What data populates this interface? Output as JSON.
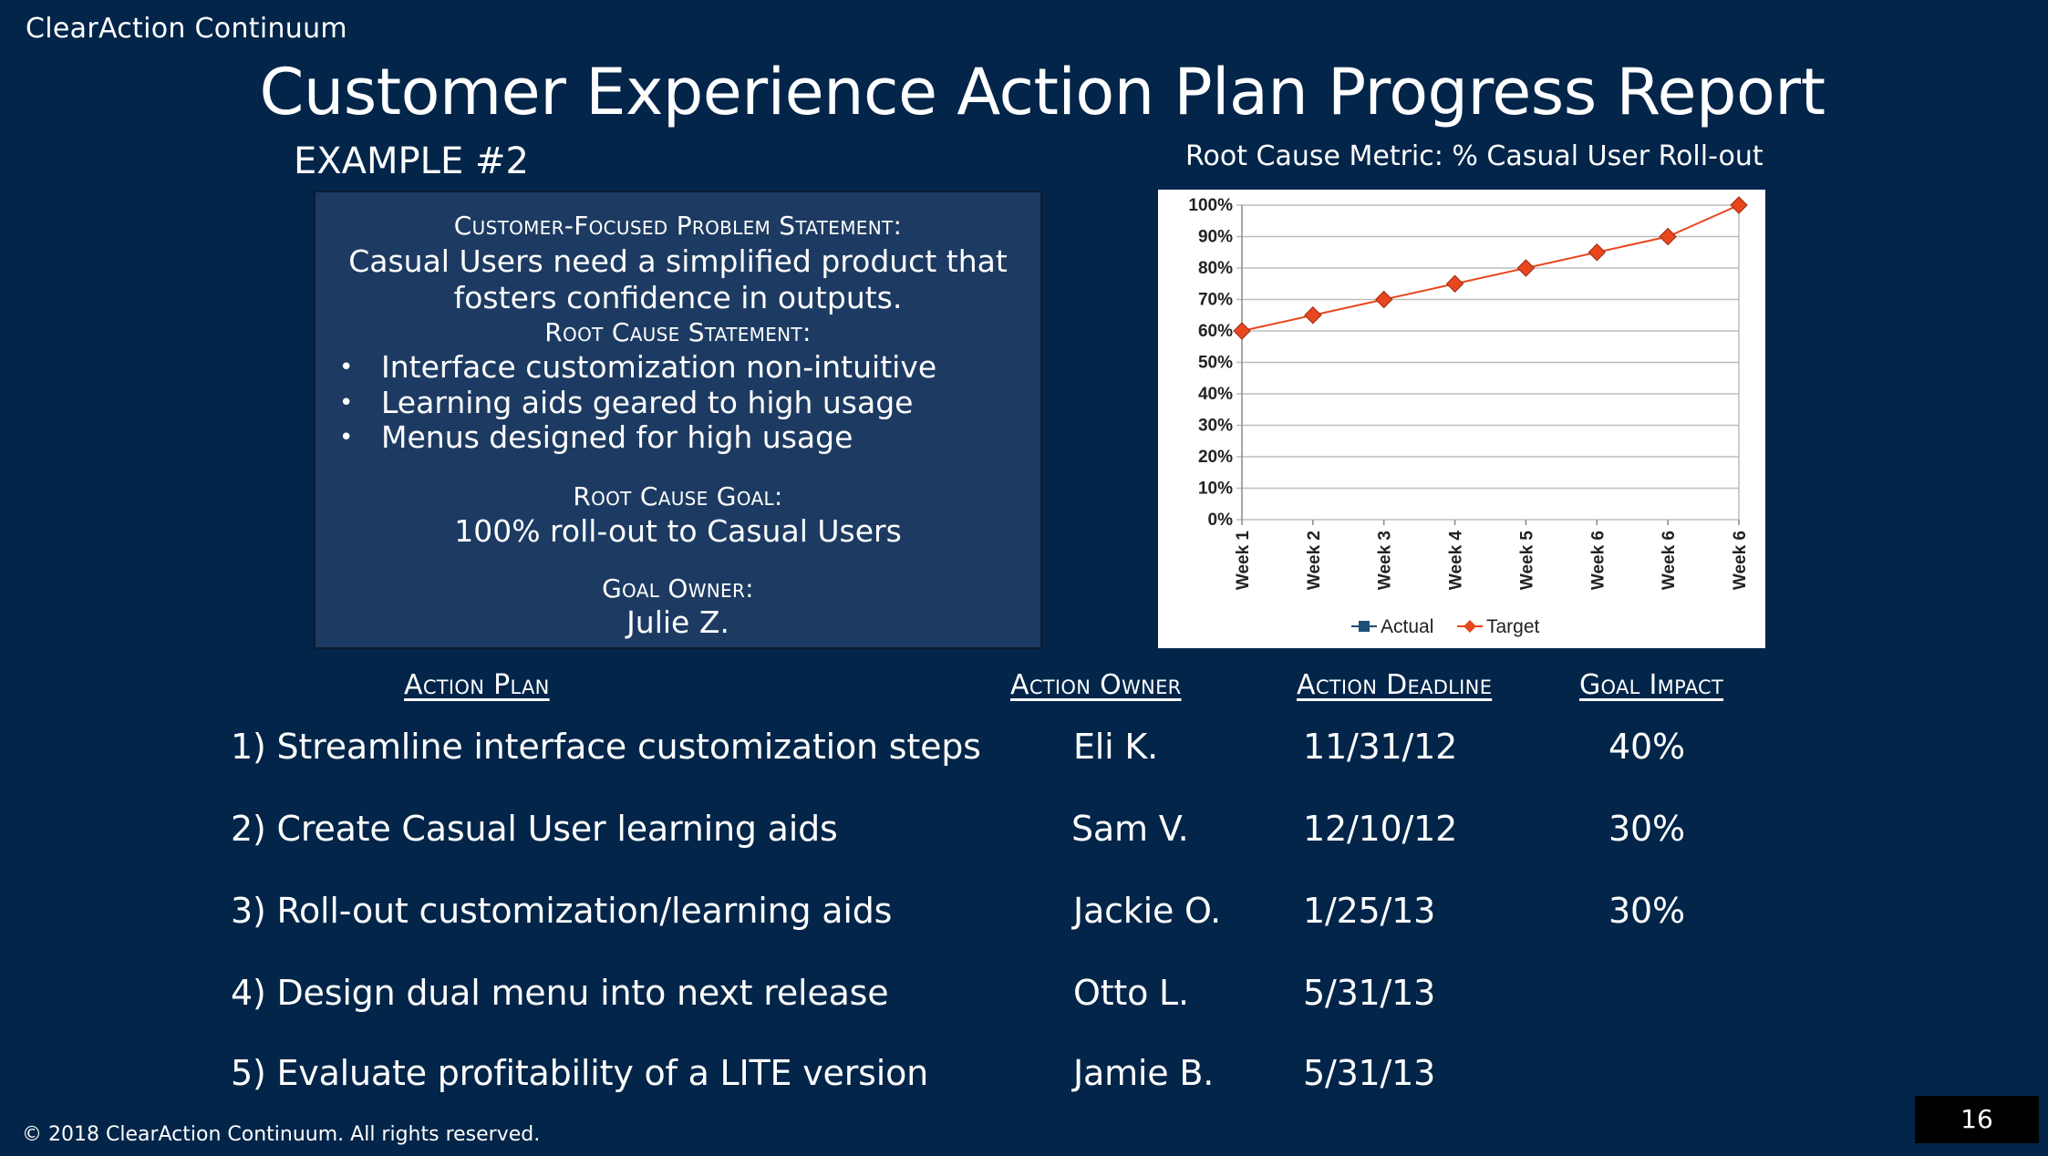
{
  "brand": "ClearAction Continuum",
  "title": "Customer Experience Action Plan Progress Report",
  "example": "EXAMPLE #2",
  "problem_box": {
    "problem_label": "Customer-Focused Problem Statement:",
    "problem_text_1": "Casual Users need a simplified product that",
    "problem_text_2": "fosters confidence in outputs.",
    "root_cause_label": "Root Cause Statement:",
    "root_causes": [
      "Interface customization non-intuitive",
      "Learning aids geared to high usage",
      "Menus designed for high usage"
    ],
    "goal_label": "Root Cause Goal:",
    "goal_text": "100% roll-out to Casual Users",
    "owner_label": "Goal Owner:",
    "owner_name": "Julie Z."
  },
  "chart_data": {
    "type": "line",
    "title": "Root Cause Metric: % Casual User Roll-out",
    "categories": [
      "Week 1",
      "Week 2",
      "Week 3",
      "Week 4",
      "Week 5",
      "Week 6",
      "Week 6",
      "Week 6"
    ],
    "y_ticks": [
      "0%",
      "10%",
      "20%",
      "30%",
      "40%",
      "50%",
      "60%",
      "70%",
      "80%",
      "90%",
      "100%"
    ],
    "ylim": [
      0,
      100
    ],
    "grid": true,
    "legend_position": "bottom",
    "series": [
      {
        "name": "Actual",
        "values": [],
        "color": "#1f4e79",
        "marker": "square"
      },
      {
        "name": "Target",
        "values": [
          60,
          65,
          70,
          75,
          80,
          85,
          90,
          100
        ],
        "color": "#e8471e",
        "marker": "diamond"
      }
    ]
  },
  "table": {
    "headers": {
      "plan": "Action Plan",
      "owner": "Action Owner",
      "deadline": "Action Deadline",
      "impact": "Goal Impact"
    },
    "rows": [
      {
        "plan": "1) Streamline interface customization steps",
        "owner": "Eli K.",
        "deadline": "11/31/12",
        "impact": "40%"
      },
      {
        "plan": "2) Create Casual User learning aids",
        "owner": "Sam V.",
        "deadline": "12/10/12",
        "impact": "30%"
      },
      {
        "plan": "3) Roll-out customization/learning aids",
        "owner": "Jackie O.",
        "deadline": "1/25/13",
        "impact": "30%"
      },
      {
        "plan": "4) Design dual menu into next release",
        "owner": "Otto L.",
        "deadline": "5/31/13",
        "impact": ""
      },
      {
        "plan": "5) Evaluate profitability of a LITE version",
        "owner": "Jamie B.",
        "deadline": "5/31/13",
        "impact": ""
      }
    ]
  },
  "footer": "© 2018 ClearAction Continuum. All rights reserved.",
  "page_number": "16"
}
